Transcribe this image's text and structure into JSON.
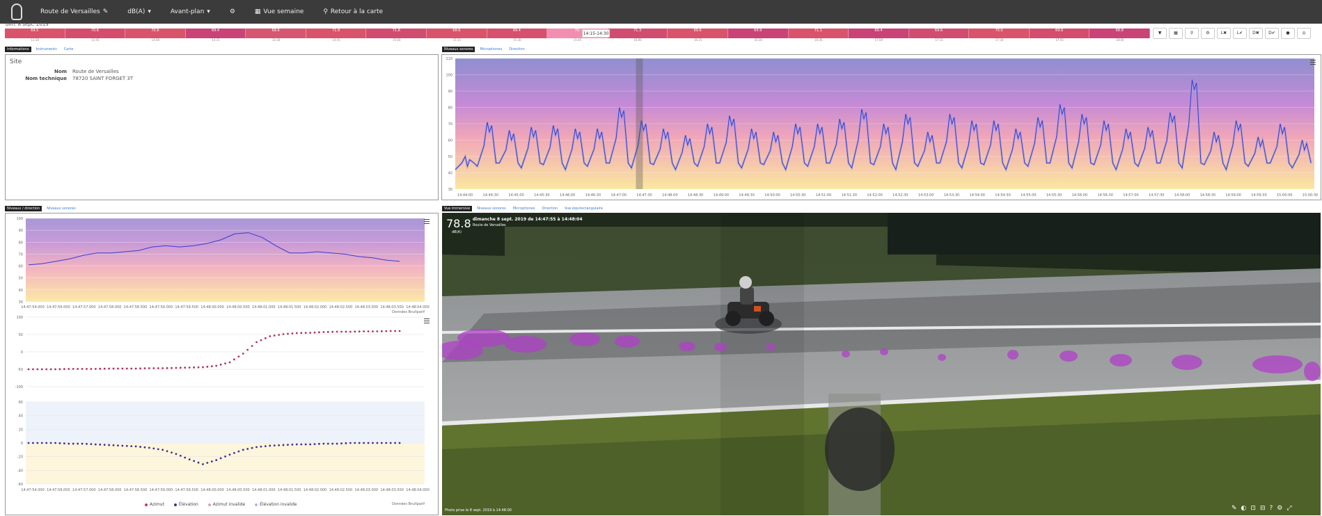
{
  "topbar": {
    "site_label": "Route de Versailles",
    "unit_label": "dB(A)",
    "foreground_label": "Avant-plan",
    "week_view_label": "Vue semaine",
    "map_return_label": "Retour à la carte"
  },
  "date_label": "dim. 8 sept. 2019",
  "timeline": {
    "segments": [
      "69.5",
      "70.6",
      "70.8",
      "69.4",
      "68.6",
      "71.8",
      "71.8",
      "68.6",
      "69.4",
      "70",
      "71.3",
      "69.6",
      "69.9",
      "71.1",
      "69.4",
      "69.6",
      "70.0",
      "69.6",
      "68.8"
    ],
    "times": [
      "13:30",
      "13:45",
      "14:00",
      "14:15",
      "14:30",
      "14:45",
      "15:00",
      "15:15",
      "15:30",
      "15:45",
      "16:00",
      "16:15",
      "16:30",
      "16:45",
      "17:00",
      "17:15",
      "17:30",
      "17:45",
      "18:00"
    ],
    "tooltip": "14:15-14:30"
  },
  "toolbar": [
    "▼",
    "▦",
    "⚲",
    "⚙",
    "L✖",
    "L✔",
    "D✖",
    "D✔",
    "●",
    "◎"
  ],
  "info_panel": {
    "tabs": [
      "Informations",
      "Instruments",
      "Carte"
    ],
    "title": "Site",
    "fields": [
      {
        "label": "Nom",
        "value": "Route de Versailles"
      },
      {
        "label": "Nom technique",
        "value": "78720 SAINT FORGET 3T"
      }
    ]
  },
  "sound_panel": {
    "tabs": [
      "Niveaux sonores",
      "Microphones",
      "Direction"
    ],
    "credit": "Données Bruitparif"
  },
  "direction_panel": {
    "tabs": [
      "Niveaux / direction",
      "Niveaux sonores"
    ],
    "credit": "Données Bruitparif",
    "legend": [
      "Azimut",
      "Élévation",
      "Azimut invalide",
      "Élévation invalide"
    ]
  },
  "immersive_panel": {
    "tabs": [
      "Vue immersive",
      "Niveaux sonores",
      "Microphones",
      "Direction",
      "Vue équirectangulaire"
    ],
    "level": "78.8",
    "level_unit": "dB(A)",
    "heading": "dimanche 8 sept. 2019 de 14:47:55 à 14:48:04",
    "subheading": "Route de Versailles",
    "photo_caption": "Photo prise le 8 sept. 2019 à 14:48:00"
  },
  "chart_data": [
    {
      "type": "line",
      "title": "Niveaux sonores",
      "ylim": [
        30,
        110
      ],
      "yticks": [
        30,
        40,
        50,
        60,
        70,
        80,
        90,
        100,
        110
      ],
      "xticks": [
        "14:44:00",
        "14:44:30",
        "14:45:00",
        "14:45:30",
        "14:46:00",
        "14:46:30",
        "14:47:00",
        "14:47:30",
        "14:48:00",
        "14:48:30",
        "14:49:00",
        "14:49:30",
        "14:50:00",
        "14:50:30",
        "14:51:00",
        "14:51:30",
        "14:52:00",
        "14:52:30",
        "14:53:00",
        "14:53:30",
        "14:54:00",
        "14:54:30",
        "14:55:00",
        "14:55:30",
        "14:56:00",
        "14:56:30",
        "14:57:00",
        "14:57:30",
        "14:58:00",
        "14:58:30",
        "14:59:00",
        "14:59:30",
        "15:00:00",
        "15:00:30"
      ],
      "peaks": [
        50,
        71,
        66,
        68,
        69,
        67,
        67,
        80,
        72,
        67,
        63,
        70,
        75,
        67,
        65,
        70,
        70,
        73,
        79,
        70,
        76,
        65,
        76,
        72,
        72,
        67,
        74,
        82,
        76,
        72,
        67,
        68,
        77,
        97,
        65,
        72,
        62,
        70,
        60
      ],
      "troughs": 42
    },
    {
      "type": "line",
      "title": "Niveaux / direction",
      "ylim": [
        30,
        100
      ],
      "yticks": [
        30,
        40,
        50,
        60,
        70,
        80,
        90,
        100
      ],
      "xticks": [
        "14:47:54.000",
        "14:47:56.000",
        "14:47:57.000",
        "14:47:58.000",
        "14:47:58.500",
        "14:47:59.000",
        "14:47:59.500",
        "14:48:00.000",
        "14:48:00.500",
        "14:48:01.000",
        "14:48:01.500",
        "14:48:02.000",
        "14:48:02.500",
        "14:48:03.000",
        "14:48:03.500",
        "14:48:04.000"
      ],
      "values": [
        61,
        62,
        64,
        66,
        69,
        71,
        71,
        72,
        73,
        76,
        77,
        76,
        77,
        79,
        82,
        87,
        88,
        84,
        77,
        71,
        71,
        72,
        71,
        70,
        68,
        67,
        65,
        64
      ]
    },
    {
      "type": "scatter",
      "title": "Azimut",
      "ylim": [
        -100,
        100
      ],
      "yticks": [
        -100,
        -50,
        0,
        50,
        100
      ],
      "values": [
        -50,
        -50,
        -50,
        -49,
        -49,
        -49,
        -48,
        -48,
        -48,
        -47,
        -47,
        -46,
        -45,
        -44,
        -40,
        -30,
        -5,
        28,
        45,
        51,
        54,
        55,
        57,
        58,
        58,
        59,
        59,
        60
      ]
    },
    {
      "type": "scatter",
      "title": "Élévation",
      "ylim": [
        -60,
        60
      ],
      "yticks": [
        -60,
        -40,
        -20,
        0,
        20,
        40,
        60
      ],
      "values": [
        0,
        0,
        0,
        -1,
        -1,
        -2,
        -3,
        -4,
        -5,
        -7,
        -10,
        -16,
        -24,
        -31,
        -25,
        -17,
        -10,
        -6,
        -4,
        -3,
        -2,
        -2,
        -1,
        -1,
        0,
        0,
        0,
        0
      ]
    }
  ]
}
